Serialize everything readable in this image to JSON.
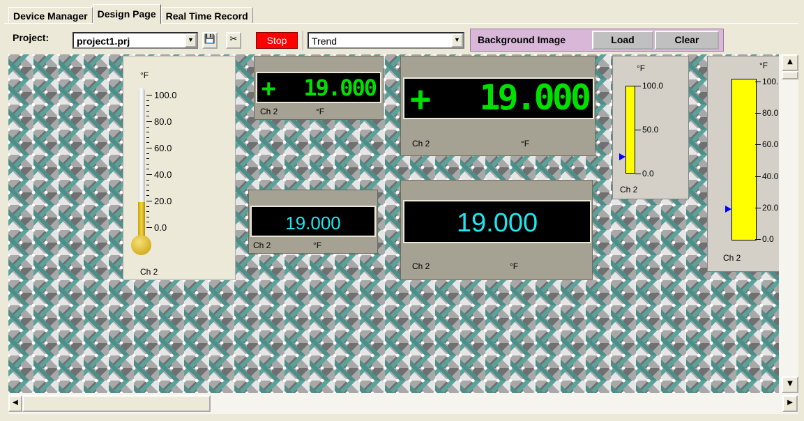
{
  "tabs": [
    "Device Manager",
    "Design Page",
    "Real Time Record"
  ],
  "toolbar": {
    "project_label": "Project:",
    "project_value": "project1.prj",
    "stop_label": "Stop",
    "mode_value": "Trend",
    "bg_label": "Background Image",
    "load_label": "Load",
    "clear_label": "Clear",
    "save_icon": "floppy-disk-icon",
    "cut_icon": "scissors-icon"
  },
  "widgets": {
    "thermo": {
      "unit": "°F",
      "ticks": [
        "100.0",
        "80.0",
        "60.0",
        "40.0",
        "20.0",
        "0.0"
      ],
      "channel": "Ch 2",
      "level": 0.19
    },
    "led_small": {
      "sign": "+",
      "value": "19.000",
      "channel": "Ch 2",
      "unit": "°F"
    },
    "led_big": {
      "sign": "+",
      "value": "19.000",
      "channel": "Ch 2",
      "unit": "°F"
    },
    "dig_small": {
      "value": "19.000",
      "channel": "Ch 2",
      "unit": "°F"
    },
    "dig_big": {
      "value": "19.000",
      "channel": "Ch 2",
      "unit": "°F"
    },
    "bar_small": {
      "unit": "°F",
      "ticks": [
        "100.0",
        "50.0",
        "0.0"
      ],
      "channel": "Ch 2",
      "level": 0.19
    },
    "bar_big": {
      "unit": "°F",
      "ticks": [
        "100.",
        "80.0",
        "60.0",
        "40.0",
        "20.0",
        "0.0"
      ],
      "channel": "Ch 2",
      "level": 0.19
    }
  },
  "colors": {
    "led": "#00e000",
    "cyan": "#1ee6f0",
    "bar": "#ffff00",
    "pointer": "#0000ff"
  }
}
